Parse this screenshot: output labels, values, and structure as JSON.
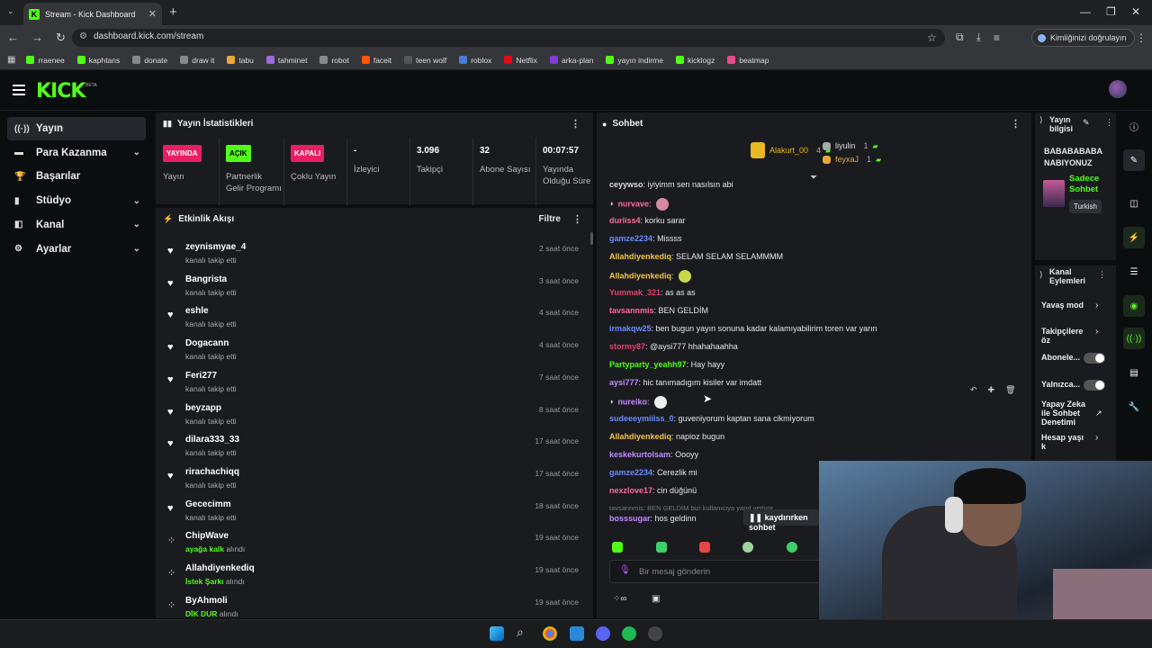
{
  "browser": {
    "tab_title": "Stream - Kick Dashboard",
    "url": "dashboard.kick.com/stream",
    "verify_label": "Kimliğinizi doğrulayın",
    "bookmarks": [
      {
        "label": "rraenee",
        "color": "#53fc18"
      },
      {
        "label": "kaphtans",
        "color": "#53fc18"
      },
      {
        "label": "donate",
        "color": "#888"
      },
      {
        "label": "draw it",
        "color": "#888"
      },
      {
        "label": "tabu",
        "color": "#e8a838"
      },
      {
        "label": "tahminet",
        "color": "#9c6bd6"
      },
      {
        "label": "robot",
        "color": "#888"
      },
      {
        "label": "faceit",
        "color": "#ff5500"
      },
      {
        "label": "teen wolf",
        "color": "#555"
      },
      {
        "label": "roblox",
        "color": "#4a7bd6"
      },
      {
        "label": "Netflix",
        "color": "#e50914"
      },
      {
        "label": "arka-plan",
        "color": "#7b3fd6"
      },
      {
        "label": "yayın indirme",
        "color": "#53fc18"
      },
      {
        "label": "kicklogz",
        "color": "#53fc18"
      },
      {
        "label": "beatmap",
        "color": "#e84b8a"
      }
    ]
  },
  "header": {
    "logo": "KICK",
    "beta": "BETA"
  },
  "sidebar": {
    "items": [
      {
        "label": "Yayın",
        "icon": "broadcast-icon",
        "chevron": false
      },
      {
        "label": "Para Kazanma",
        "icon": "money-icon",
        "chevron": true
      },
      {
        "label": "Başarılar",
        "icon": "trophy-icon",
        "chevron": false
      },
      {
        "label": "Stüdyo",
        "icon": "studio-icon",
        "chevron": true
      },
      {
        "label": "Kanal",
        "icon": "channel-icon",
        "chevron": true
      },
      {
        "label": "Ayarlar",
        "icon": "gear-icon",
        "chevron": true
      }
    ]
  },
  "stats": {
    "title": "Yayın İstatistikleri",
    "items": [
      {
        "badge": "YAYINDA",
        "badge_color": "#e91e63",
        "label": "Yayın"
      },
      {
        "badge": "AÇIK",
        "badge_color": "#53fc18",
        "label": "Partnerlik Gelir Programı"
      },
      {
        "badge": "KAPALI",
        "badge_color": "#e91e63",
        "label": "Çoklu Yayın"
      },
      {
        "value": "-",
        "label": "İzleyici"
      },
      {
        "value": "3.096",
        "label": "Takipçi"
      },
      {
        "value": "32",
        "label": "Abone Sayısı"
      },
      {
        "value": "00:07:57",
        "label": "Yayında Olduğu Süre"
      }
    ]
  },
  "feed": {
    "title": "Etkinlik Akışı",
    "filter": "Filtre",
    "items": [
      {
        "name": "zeynismyae_4",
        "sub": "kanalı takip etti",
        "time": "2 saat önce",
        "icon": "heart"
      },
      {
        "name": "Bangrista",
        "sub": "kanalı takip etti",
        "time": "3 saat önce",
        "icon": "heart"
      },
      {
        "name": "eshle",
        "sub": "kanalı takip etti",
        "time": "4 saat önce",
        "icon": "heart"
      },
      {
        "name": "Dogacann",
        "sub": "kanalı takip etti",
        "time": "4 saat önce",
        "icon": "heart"
      },
      {
        "name": "Feri277",
        "sub": "kanalı takip etti",
        "time": "7 saat önce",
        "icon": "heart"
      },
      {
        "name": "beyzapp",
        "sub": "kanalı takip etti",
        "time": "8 saat önce",
        "icon": "heart"
      },
      {
        "name": "dilara333_33",
        "sub": "kanalı takip etti",
        "time": "17 saat önce",
        "icon": "heart"
      },
      {
        "name": "rirachachiqq",
        "sub": "kanalı takip etti",
        "time": "17 saat önce",
        "icon": "heart"
      },
      {
        "name": "Gececimm",
        "sub": "kanalı takip etti",
        "time": "18 saat önce",
        "icon": "heart"
      },
      {
        "name": "ChipWave",
        "reward": "ayağa kalk",
        "sub": "alındı",
        "time": "19 saat önce",
        "icon": "reward"
      },
      {
        "name": "Allahdiyenkediq",
        "reward": "İstek Şarkı",
        "sub": "alındı",
        "time": "19 saat önce",
        "icon": "reward"
      },
      {
        "name": "ByAhmoli",
        "reward": "DİK DUR",
        "sub": "alındı",
        "time": "19 saat önce",
        "icon": "reward"
      }
    ]
  },
  "chat": {
    "title": "Sohbet",
    "leaders": [
      {
        "name": "Alakurt_00",
        "count": "4",
        "color": "#e8b923"
      },
      {
        "name": "liyulin",
        "count": "1",
        "color": "#aaa"
      },
      {
        "name": "feyxaJ",
        "count": "1",
        "color": "#e8a838"
      }
    ],
    "messages": [
      {
        "user": "ceyywso",
        "color": "#ddd",
        "text": "iyiyimm sen nasılsın abi"
      },
      {
        "user": "nurvave",
        "color": "#ff6b9a",
        "text": ""
      },
      {
        "user": "duriiss4",
        "color": "#ff6b9a",
        "text": "korku sarar"
      },
      {
        "user": "gamze2234",
        "color": "#6b8cff",
        "text": "Missss"
      },
      {
        "user": "Allahdiyenkediq",
        "color": "#f5c542",
        "text": "SELAM SELAM SELAMMMM"
      },
      {
        "user": "Allahdiyenkediq",
        "color": "#f5c542",
        "text": ""
      },
      {
        "user": "Yummak_321",
        "color": "#e8416b",
        "text": "as as as"
      },
      {
        "user": "tavsannmis",
        "color": "#ff6b9a",
        "text": "BEN GELDİM"
      },
      {
        "user": "irmakqw25",
        "color": "#6b8cff",
        "text": "ben bugun yayın sonuna kadar kalamıyabilirim toren var yarın"
      },
      {
        "user": "stormy87",
        "color": "#e8416b",
        "text": "@aysi777 hhahahaahha"
      },
      {
        "user": "Partyparty_yeahh97",
        "color": "#53fc18",
        "text": "Hay hayy"
      },
      {
        "user": "aysi777",
        "color": "#c58aff",
        "text": "hic tanımadıgım kisiler var imdatt"
      },
      {
        "user": "nureiko",
        "color": "#c58aff",
        "text": ""
      },
      {
        "user": "sudeeeymiiiss_0",
        "color": "#6b8cff",
        "text": "guveniyorum kaptan sana cikmiyorum"
      },
      {
        "user": "Allahdiyenkediq",
        "color": "#f5c542",
        "text": "napioz bugun"
      },
      {
        "user": "keskekurtolsam",
        "color": "#c58aff",
        "text": "Oooyy"
      },
      {
        "user": "gamze2234",
        "color": "#6b8cff",
        "text": "Cerezlik mi"
      },
      {
        "user": "nexzlove17",
        "color": "#ff6b9a",
        "text": "cin düğünü"
      },
      {
        "user": "bosssugar",
        "color": "#c58aff",
        "text": "hos geldinn"
      }
    ],
    "reply": "tavsannmis: BEN GELDİM bizi kullanıcıya yanıt veriyor",
    "scroll_pause": "kaydırırken sohbet",
    "input_placeholder": "Bir mesaj gönderin"
  },
  "info": {
    "title": "Yayın bilgisi",
    "stream_title": "BABABABABA NABIYONUZ",
    "category": "Sadece Sohbet",
    "language": "Turkish"
  },
  "actions": {
    "title": "Kanal Eylemleri",
    "items": [
      {
        "label": "Yavaş mod",
        "control": "chevron"
      },
      {
        "label": "Takipçilere öz",
        "control": "chevron"
      },
      {
        "label": "Abonele...",
        "control": "toggle"
      },
      {
        "label": "Yalnızca...",
        "control": "toggle"
      },
      {
        "label": "Yapay Zeka ile Sohbet Denetimi",
        "control": "external"
      },
      {
        "label": "Hesap yaşı k",
        "control": "chevron"
      }
    ]
  }
}
